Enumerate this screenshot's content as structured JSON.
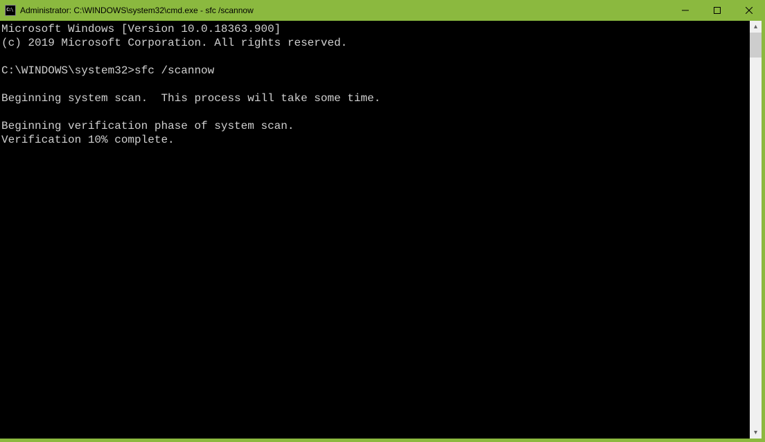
{
  "window": {
    "title": "Administrator: C:\\WINDOWS\\system32\\cmd.exe - sfc  /scannow"
  },
  "console": {
    "lines": {
      "version": "Microsoft Windows [Version 10.0.18363.900]",
      "copyright": "(c) 2019 Microsoft Corporation. All rights reserved.",
      "prompt": "C:\\WINDOWS\\system32>",
      "command": "sfc /scannow",
      "scan_start": "Beginning system scan.  This process will take some time.",
      "verify_phase": "Beginning verification phase of system scan.",
      "verify_progress": "Verification 10% complete."
    }
  }
}
